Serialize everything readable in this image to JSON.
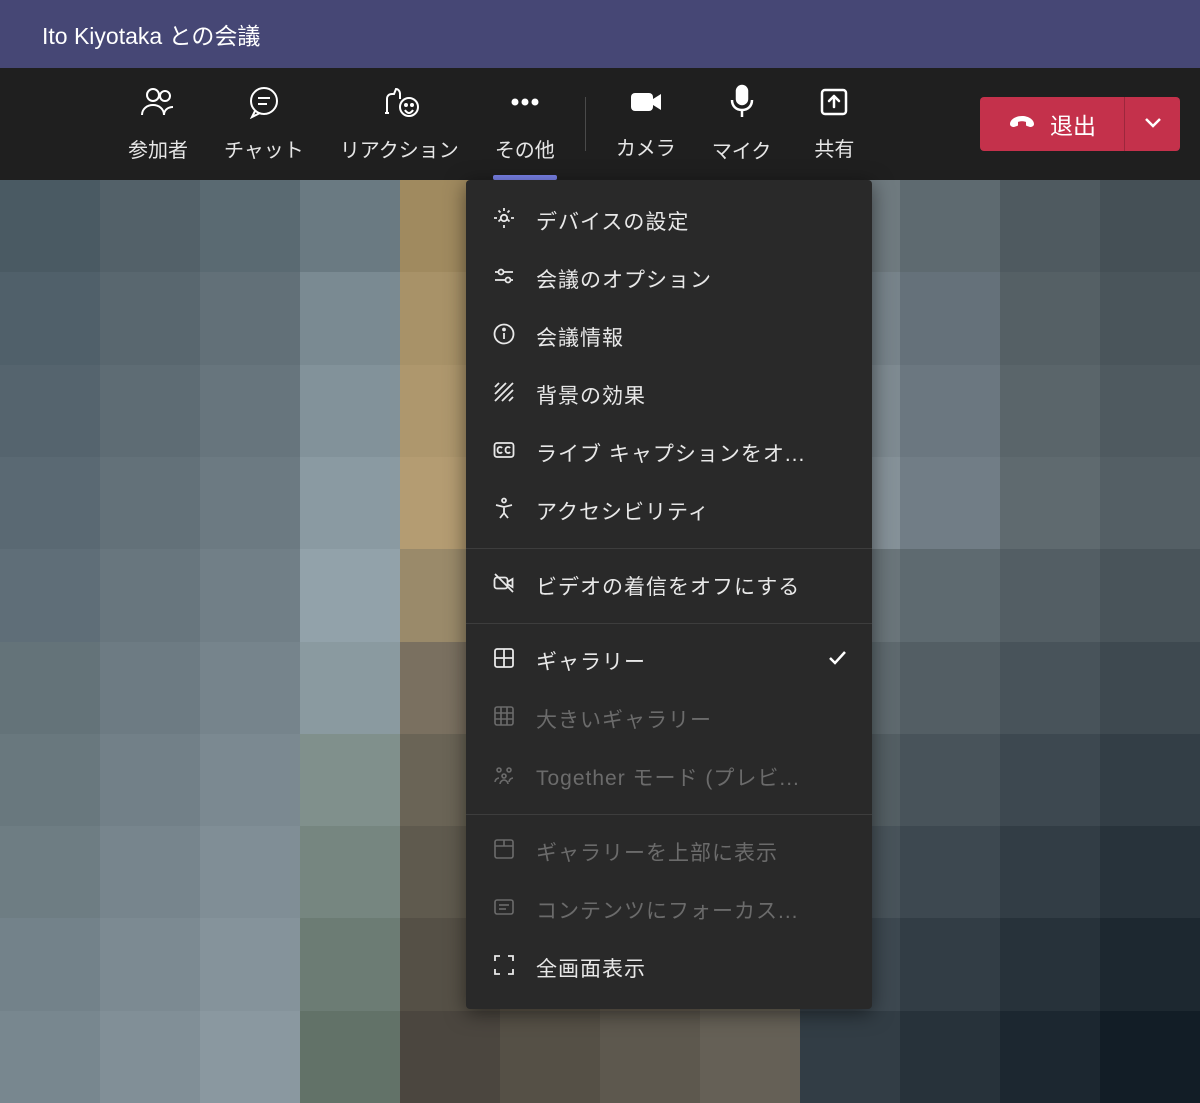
{
  "titlebar": {
    "title": "Ito Kiyotaka との会議"
  },
  "toolbar": {
    "participants": "参加者",
    "chat": "チャット",
    "reactions": "リアクション",
    "more": "その他",
    "camera": "カメラ",
    "mic": "マイク",
    "share": "共有"
  },
  "leave": {
    "label": "退出"
  },
  "dropdown": {
    "device_settings": "デバイスの設定",
    "meeting_options": "会議のオプション",
    "meeting_info": "会議情報",
    "background_effects": "背景の効果",
    "live_captions": "ライブ キャプションをオ...",
    "accessibility": "アクセシビリティ",
    "incoming_video_off": "ビデオの着信をオフにする",
    "gallery": "ギャラリー",
    "large_gallery": "大きいギャラリー",
    "together_mode": "Together モード (プレビ...",
    "gallery_top": "ギャラリーを上部に表示",
    "focus_content": "コンテンツにフォーカス...",
    "fullscreen": "全画面表示"
  },
  "colors": {
    "titlebar": "#464775",
    "toolbar": "#1f1f1f",
    "dropdown": "#292929",
    "accent": "#7b83eb",
    "leave": "#c4314b"
  }
}
